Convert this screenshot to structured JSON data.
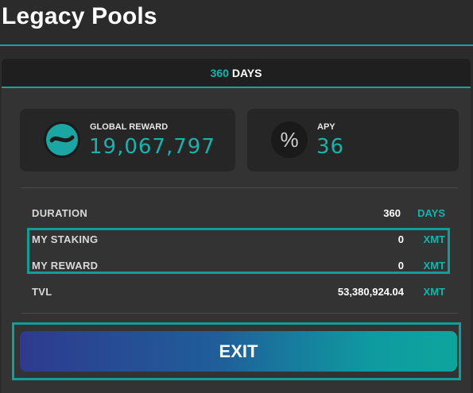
{
  "header": {
    "title": "Legacy Pools"
  },
  "tab": {
    "number": "360",
    "unit": "DAYS"
  },
  "global_reward": {
    "label": "GLOBAL REWARD",
    "value": "19,067,797"
  },
  "apy": {
    "label": "APY",
    "value": "36",
    "icon": "%"
  },
  "rows": {
    "duration": {
      "label": "DURATION",
      "value": "360",
      "unit": "DAYS"
    },
    "my_staking": {
      "label": "MY STAKING",
      "value": "0",
      "unit": "XMT"
    },
    "my_reward": {
      "label": "MY REWARD",
      "value": "0",
      "unit": "XMT"
    },
    "tvl": {
      "label": "TVL",
      "value": "53,380,924.04",
      "unit": "XMT"
    }
  },
  "actions": {
    "exit_label": "EXIT"
  },
  "colors": {
    "accent": "#17b3ae",
    "background": "#2b2b2b",
    "panel": "#333333"
  }
}
